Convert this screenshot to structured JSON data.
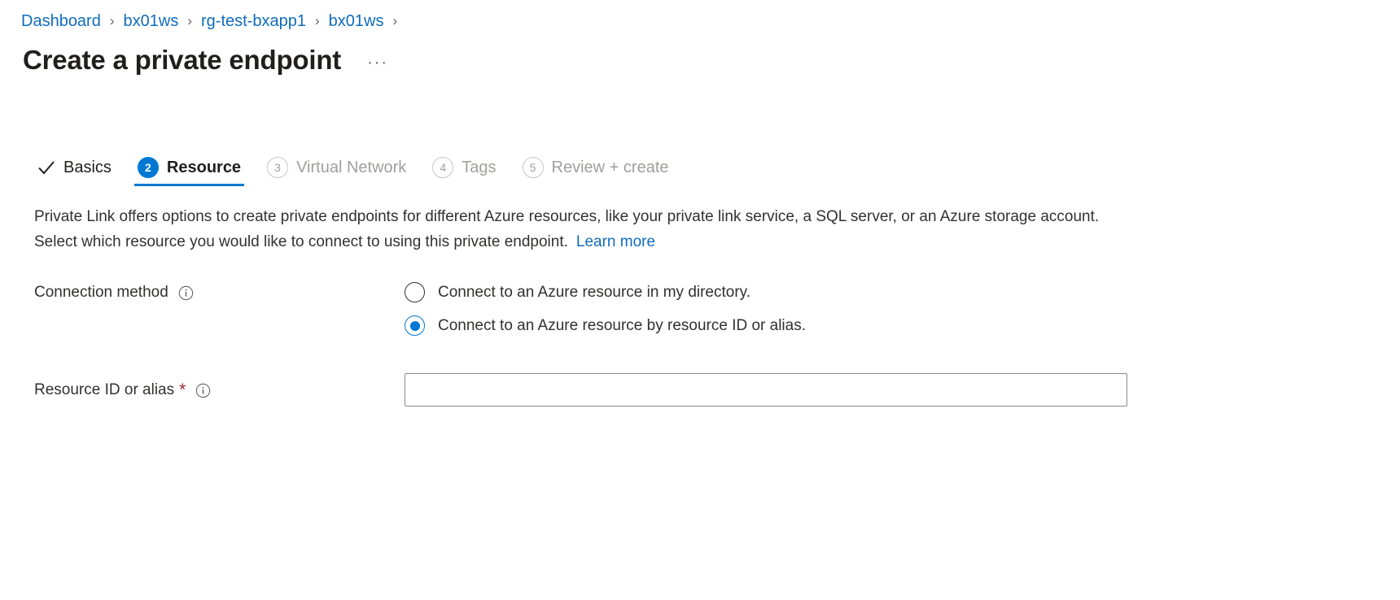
{
  "breadcrumb": {
    "separator": "›",
    "items": [
      {
        "label": "Dashboard"
      },
      {
        "label": "bx01ws"
      },
      {
        "label": "rg-test-bxapp1"
      },
      {
        "label": "bx01ws"
      }
    ]
  },
  "header": {
    "title": "Create a private endpoint",
    "more_menu": "···"
  },
  "tabs": [
    {
      "label": "Basics",
      "marker": "check",
      "state": "done"
    },
    {
      "label": "Resource",
      "marker": "2",
      "state": "active"
    },
    {
      "label": "Virtual Network",
      "marker": "3",
      "state": "upcoming"
    },
    {
      "label": "Tags",
      "marker": "4",
      "state": "upcoming"
    },
    {
      "label": "Review + create",
      "marker": "5",
      "state": "upcoming"
    }
  ],
  "description": {
    "text": "Private Link offers options to create private endpoints for different Azure resources, like your private link service, a SQL server, or an Azure storage account. Select which resource you would like to connect to using this private endpoint.",
    "link_label": "Learn more"
  },
  "form": {
    "connection_method": {
      "label": "Connection method",
      "options": [
        {
          "label": "Connect to an Azure resource in my directory.",
          "selected": false
        },
        {
          "label": "Connect to an Azure resource by resource ID or alias.",
          "selected": true
        }
      ]
    },
    "resource_id": {
      "label": "Resource ID or alias",
      "required_marker": "*",
      "value": "",
      "placeholder": ""
    }
  },
  "colors": {
    "accent": "#0078d4",
    "link": "#0f6cbd",
    "required": "#a4262c",
    "text": "#323130",
    "muted": "#a19f9d",
    "border": "#8a8886"
  }
}
